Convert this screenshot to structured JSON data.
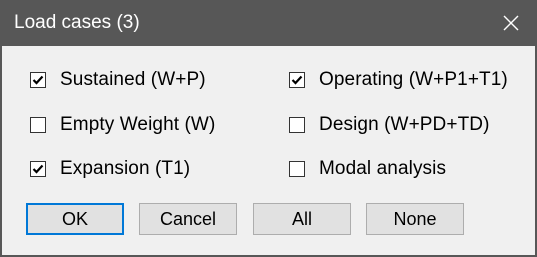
{
  "window": {
    "title": "Load cases (3)",
    "close_icon": "close-x-icon"
  },
  "options": [
    {
      "label": "Sustained (W+P)",
      "checked": true
    },
    {
      "label": "Operating (W+P1+T1)",
      "checked": true
    },
    {
      "label": "Empty Weight (W)",
      "checked": false
    },
    {
      "label": "Design (W+PD+TD)",
      "checked": false
    },
    {
      "label": "Expansion (T1)",
      "checked": true
    },
    {
      "label": "Modal analysis",
      "checked": false
    }
  ],
  "buttons": {
    "ok": "OK",
    "cancel": "Cancel",
    "all": "All",
    "none": "None"
  },
  "colors": {
    "titlebar": "#575757",
    "face": "#f0f0f0",
    "button": "#e1e1e1",
    "default_border": "#0078d7"
  }
}
